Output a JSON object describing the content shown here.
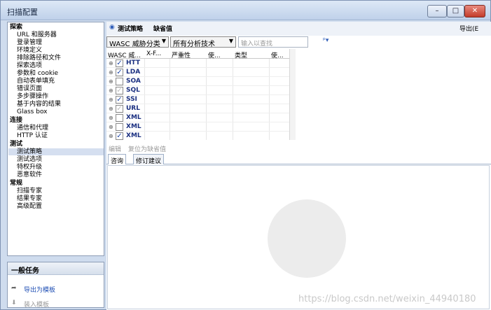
{
  "window": {
    "title": "扫描配置",
    "minimize": "–",
    "maximize": "□",
    "close": "✕"
  },
  "nav": {
    "groups": [
      {
        "header": "探索",
        "items": [
          "URL 和服务器",
          "登录管理",
          "环境定义",
          "排除路径和文件",
          "探索选项",
          "参数和 cookie",
          "自动表单填充",
          "错误页面",
          "多步骤操作",
          "基于内容的结果",
          "Glass box"
        ]
      },
      {
        "header": "连接",
        "items": [
          "通信和代理",
          "HTTP 认证"
        ]
      },
      {
        "header": "测试",
        "items": [
          "测试策略",
          "测试选项",
          "特权升级",
          "恶意软件"
        ]
      },
      {
        "header": "常规",
        "items": [
          "扫描专家",
          "结果专家",
          "高级配置"
        ]
      }
    ],
    "selected": "测试策略"
  },
  "tasks": {
    "header": "一般任务",
    "items": [
      "导出为模板",
      "装入模板"
    ]
  },
  "right": {
    "tab_label": "测试策略",
    "tab_value": "缺省值",
    "export_label": "导出(E",
    "filter1": "WASC 威胁分类",
    "filter2": "所有分析技术",
    "search_placeholder": "输入以查找",
    "columns": [
      "WASC 威...",
      "X-F...",
      "严重性",
      "使...",
      "类型",
      "使..."
    ],
    "rows": [
      {
        "name": "HTT",
        "check": "checked"
      },
      {
        "name": "LDA",
        "check": "checked"
      },
      {
        "name": "SOA",
        "check": "unchecked"
      },
      {
        "name": "SQL",
        "check": "light"
      },
      {
        "name": "SSI",
        "check": "checked"
      },
      {
        "name": "URL",
        "check": "light"
      },
      {
        "name": "XML",
        "check": "unchecked"
      },
      {
        "name": "XML",
        "check": "unchecked"
      },
      {
        "name": "XML",
        "check": "checked"
      }
    ],
    "actions": [
      "编辑",
      "复位为缺省值"
    ],
    "subtabs": [
      "咨询",
      "修订建议"
    ],
    "watermark_text": "https://blog.csdn.net/weixin_44940180"
  }
}
